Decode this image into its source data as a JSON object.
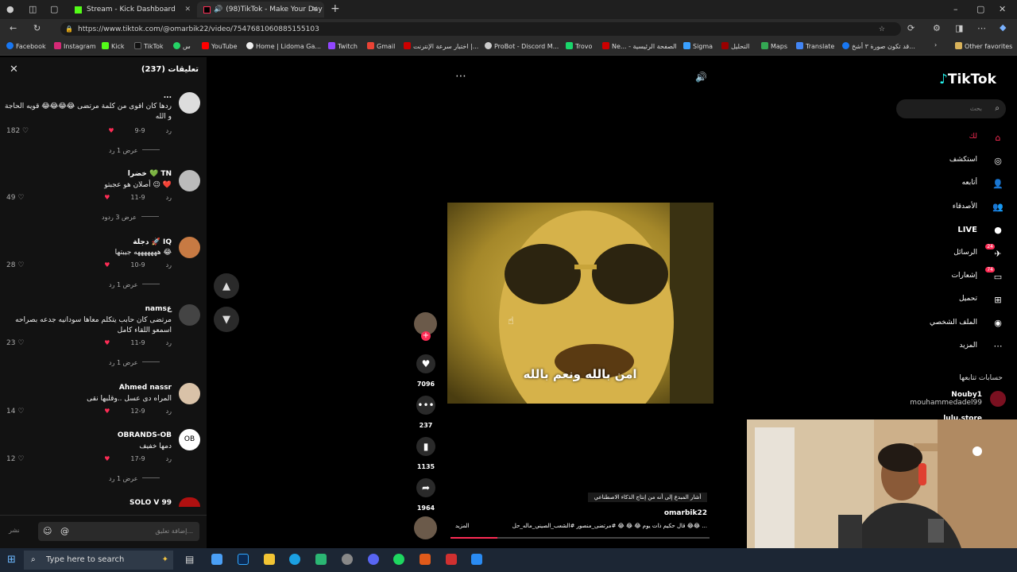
{
  "browser": {
    "tabs": [
      {
        "label": "Stream - Kick Dashboard",
        "active": false
      },
      {
        "label": "(98)TikTok - Make Your Day",
        "active": true
      }
    ],
    "url": "https://www.tiktok.com/@omarbik22/video/7547681060885155103",
    "bookmarks": [
      "Facebook",
      "Instagram",
      "Kick",
      "TikTok",
      "س",
      "YouTube",
      "Home | Lidoma Ga...",
      "Twitch",
      "Gmail",
      "اختبار سرعة الإنترنت |...",
      "ProBot - Discord M...",
      "Trovo",
      "Ne... - الصفحة الرئيسية",
      "Sigma",
      "التحليل",
      "Maps",
      "Translate",
      "قد تكون صورة ٣ أشخ...",
      "Other favorites"
    ]
  },
  "comments_panel": {
    "title": "تعليقات (237)",
    "comments": [
      {
        "name": "...",
        "text": "ردها كان اقوى من كلمة مرتضى 😂😂😂😂 قويه الحاجة و الله",
        "date": "9-9",
        "reply": "رد",
        "likes": "182",
        "more": "عرض 1 رد"
      },
      {
        "name": "خضرا 💚 TN",
        "text": "أصلان هو عجبتو 😉 ❤️",
        "date": "9-11",
        "reply": "رد",
        "likes": "49",
        "more": "عرض 3 ردود"
      },
      {
        "name": "دجلة 🚀 IQ",
        "text": "هههههههه جيبتها 😂",
        "date": "9-10",
        "reply": "رد",
        "likes": "28",
        "more": "عرض 1 رد"
      },
      {
        "name": "namsع",
        "text": "مرتضى كان حابب يتكلم معاها سودانيه جدعه بصراحه اسمعو اللقاء كامل",
        "date": "9-11",
        "reply": "رد",
        "likes": "23",
        "more": "عرض 1 رد"
      },
      {
        "name": "Ahmed nassr",
        "text": "المراه دى عسل ..وقلبها نقى",
        "date": "9-12",
        "reply": "رد",
        "likes": "14",
        "more": ""
      },
      {
        "name": "OBRANDS-OB",
        "text": "دمها خفيف",
        "date": "9-17",
        "reply": "رد",
        "likes": "12",
        "more": "عرض 1 رد"
      },
      {
        "name": "SOLO V 99",
        "text": "",
        "date": "",
        "reply": "",
        "likes": "",
        "more": ""
      }
    ],
    "input_placeholder": "إضافة تعليق...",
    "post_label": "نشر"
  },
  "video": {
    "caption": "امن بالله ونعم بالله",
    "likes": "7096",
    "comments": "237",
    "saves": "1135",
    "shares": "1964",
    "author": "omarbik22",
    "description_line1": "أشار المبدع إلى أنه من إنتاج الذكاء الاصطناعي",
    "description_line2": "قال حكيم ذات يوم 😂 😂 😂 #مرتضى_منصور #الشعب_الصيني_ماله_حل 😂😂 ...",
    "more_label": "المزيد",
    "progress": 0.18
  },
  "sidebar": {
    "logo": "TikTok",
    "search_placeholder": "بحث",
    "items": [
      {
        "label": "لك",
        "icon": "home-icon",
        "active": true
      },
      {
        "label": "استكشف",
        "icon": "compass-icon"
      },
      {
        "label": "أتابعه",
        "icon": "following-icon"
      },
      {
        "label": "الأصدقاء",
        "icon": "friends-icon"
      },
      {
        "label": "LIVE",
        "icon": "live-icon"
      },
      {
        "label": "الرسائل",
        "icon": "messages-icon",
        "badge": "24"
      },
      {
        "label": "إشعارات",
        "icon": "notifications-icon",
        "badge": "74"
      },
      {
        "label": "تحميل",
        "icon": "upload-icon"
      },
      {
        "label": "الملف الشخصي",
        "icon": "profile-icon"
      },
      {
        "label": "المزيد",
        "icon": "more-icon"
      }
    ],
    "following_title": "حسابات تتابعها",
    "following": [
      {
        "name": "Nouby1",
        "handle": "mouhammedadel99"
      },
      {
        "name": "lulu.store",
        "handle": ""
      }
    ]
  },
  "taskbar": {
    "search_placeholder": "Type here to search"
  },
  "colors": {
    "accent": "#fe2c55",
    "panel": "#121212"
  }
}
